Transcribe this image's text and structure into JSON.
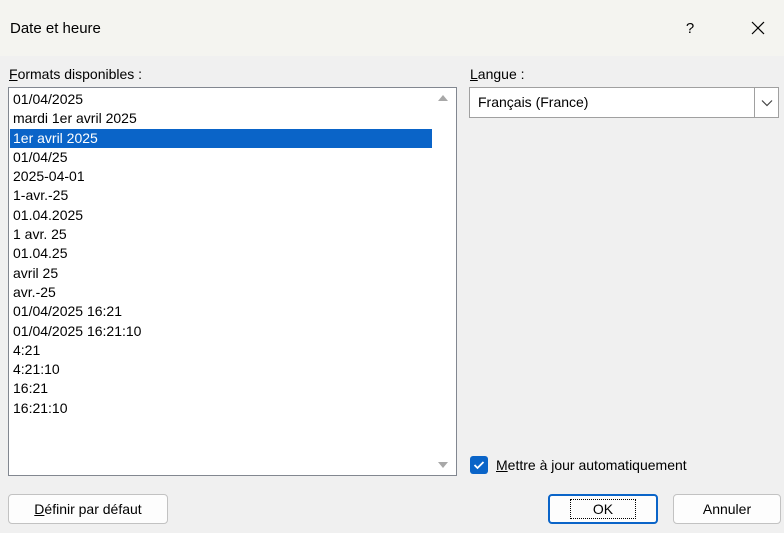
{
  "window": {
    "title": "Date et heure",
    "help_label": "?",
    "close_label": "×"
  },
  "formats": {
    "label_prefix": "F",
    "label_rest": "ormats disponibles :",
    "selected_index": 2,
    "items": [
      "01/04/2025",
      "mardi 1er avril 2025",
      "1er avril 2025",
      "01/04/25",
      "2025-04-01",
      "1-avr.-25",
      "01.04.2025",
      "1 avr. 25",
      "01.04.25",
      "avril 25",
      "avr.-25",
      "01/04/2025 16:21",
      "01/04/2025 16:21:10",
      "4:21",
      "4:21:10",
      "16:21",
      "16:21:10"
    ]
  },
  "language": {
    "label_prefix": "L",
    "label_rest": "angue :",
    "value": "Français (France)"
  },
  "auto_update": {
    "label_prefix": "M",
    "label_rest": "ettre à jour automatiquement",
    "checked": true
  },
  "buttons": {
    "set_default_prefix": "D",
    "set_default_rest": "éfinir par défaut",
    "ok": "OK",
    "cancel": "Annuler"
  },
  "colors": {
    "accent": "#0a64c8",
    "background": "#f0f0f0"
  }
}
